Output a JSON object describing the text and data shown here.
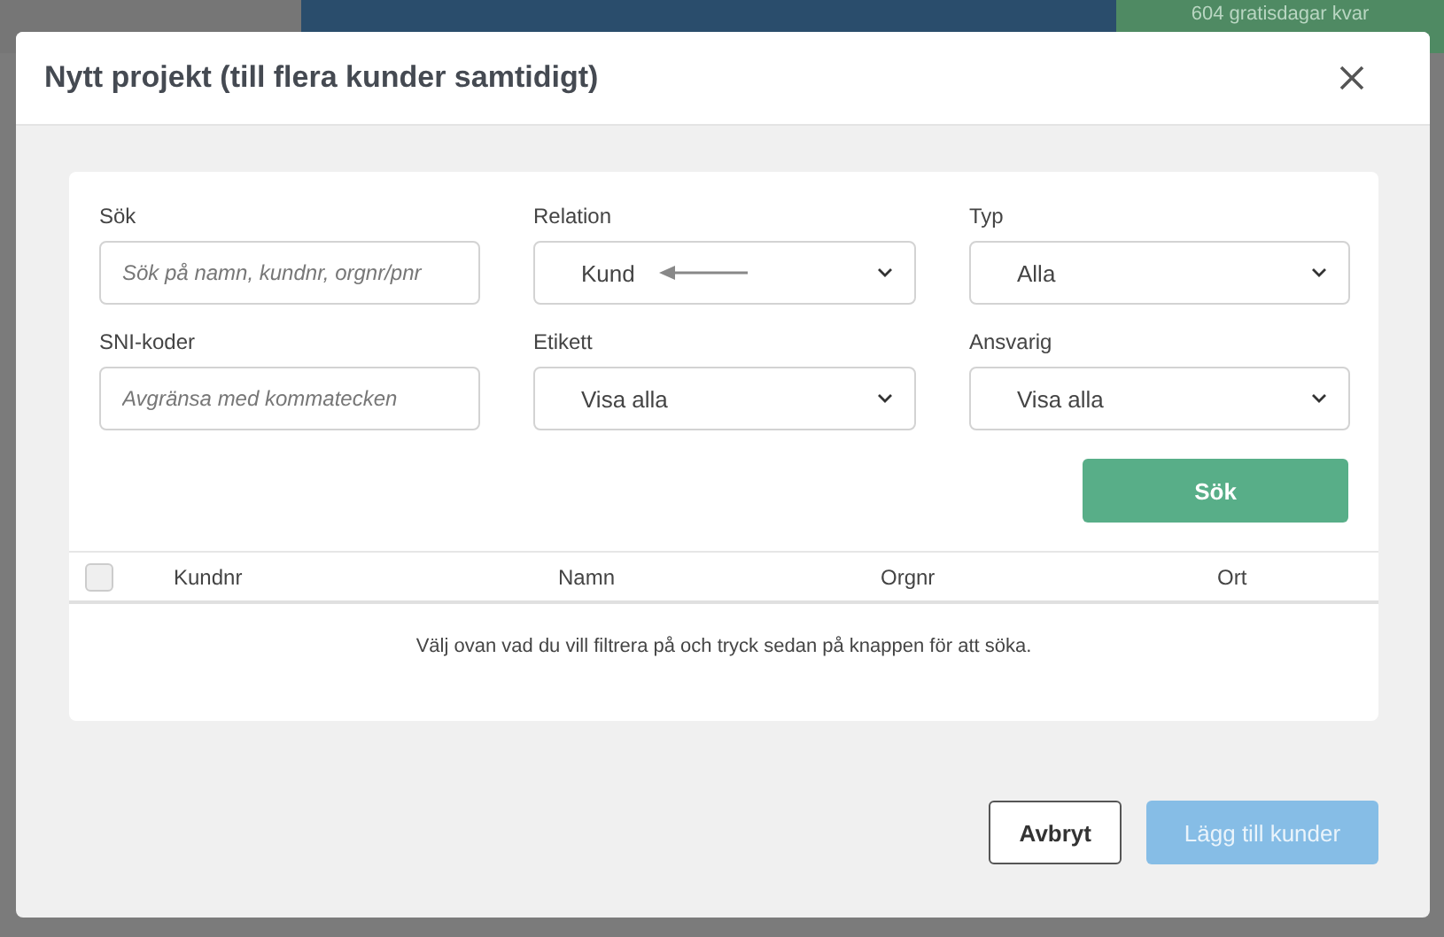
{
  "backdrop": {
    "badge": "604 gratisdagar kvar"
  },
  "dialog": {
    "title": "Nytt projekt (till flera kunder samtidigt)",
    "filters": [
      {
        "kind": "text",
        "label": "Sök",
        "placeholder": "Sök på namn, kundnr, orgnr/pnr"
      },
      {
        "kind": "select",
        "label": "Relation",
        "value": "Kund",
        "arrow": true
      },
      {
        "kind": "select",
        "label": "Typ",
        "value": "Alla"
      },
      {
        "kind": "text",
        "label": "SNI-koder",
        "placeholder": "Avgränsa med kommatecken"
      },
      {
        "kind": "select",
        "label": "Etikett",
        "value": "Visa alla"
      },
      {
        "kind": "select",
        "label": "Ansvarig",
        "value": "Visa alla"
      }
    ],
    "search_button": "Sök",
    "table": {
      "select_all_checked": false,
      "columns": [
        "Kundnr",
        "Namn",
        "Orgnr",
        "Ort"
      ],
      "empty_message": "Välj ovan vad du vill filtrera på och tryck sedan på knappen för att söka."
    },
    "buttons": [
      {
        "label": "Avbryt",
        "kind": "secondary",
        "disabled": false
      },
      {
        "label": "Lägg till kunder",
        "kind": "primary",
        "disabled": true
      }
    ]
  }
}
